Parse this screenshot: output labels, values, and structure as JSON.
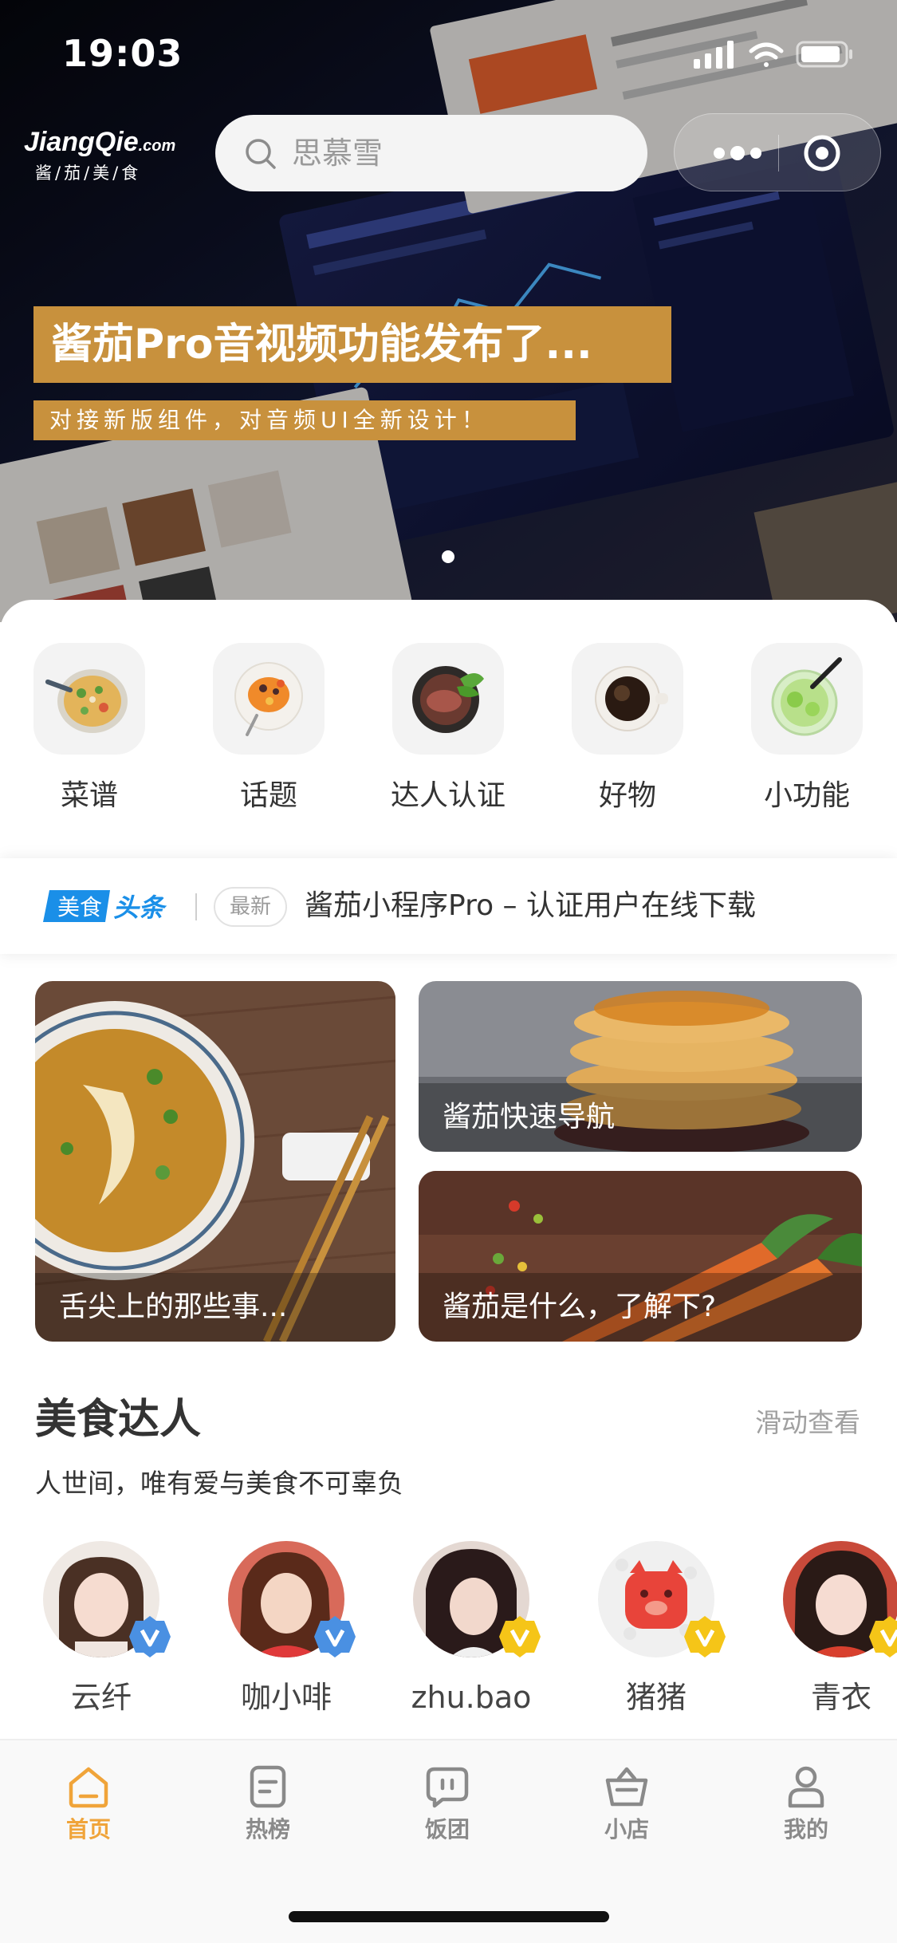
{
  "status_bar": {
    "time": "19:03"
  },
  "brand": {
    "name": "JiangQie",
    "suffix": ".com",
    "subtitle": "酱/茄/美/食"
  },
  "search": {
    "placeholder": "思慕雪"
  },
  "banner": {
    "title": "酱茄Pro音视频功能发布了...",
    "subtitle": "对接新版组件，对音频UI全新设计！",
    "pages": 1,
    "active_page": 1
  },
  "categories": [
    {
      "label": "菜谱",
      "icon": "noodle-bowl-icon"
    },
    {
      "label": "话题",
      "icon": "fruit-plate-icon"
    },
    {
      "label": "达人认证",
      "icon": "steak-plate-icon"
    },
    {
      "label": "好物",
      "icon": "coffee-cup-icon"
    },
    {
      "label": "小功能",
      "icon": "lime-drink-icon"
    }
  ],
  "news": {
    "logo_part1": "美食",
    "logo_part2": "头条",
    "badge": "最新",
    "text": "酱茄小程序Pro – 认证用户在线下载"
  },
  "cards": {
    "left": "舌尖上的那些事...",
    "top_right": "酱茄快速导航",
    "bottom_right": "酱茄是什么，了解下?"
  },
  "experts_section": {
    "title": "美食达人",
    "more": "滑动查看",
    "subtitle": "人世间，唯有爱与美食不可辜负",
    "items": [
      {
        "name": "云纤",
        "badge_color": "#4a90e2"
      },
      {
        "name": "咖小啡",
        "badge_color": "#4a90e2"
      },
      {
        "name": "zhu.bao",
        "badge_color": "#f5c518"
      },
      {
        "name": "猪猪",
        "badge_color": "#f5c518"
      },
      {
        "name": "青衣",
        "badge_color": "#f5c518"
      }
    ]
  },
  "tabbar": {
    "active": "首页",
    "items": [
      {
        "label": "首页",
        "icon": "home-icon"
      },
      {
        "label": "热榜",
        "icon": "list-icon"
      },
      {
        "label": "饭团",
        "icon": "chat-bubble-icon"
      },
      {
        "label": "小店",
        "icon": "basket-icon"
      },
      {
        "label": "我的",
        "icon": "person-icon"
      }
    ]
  },
  "colors": {
    "accent": "#f0a43a",
    "banner_label": "#c8913d",
    "news_logo": "#1a8fe8",
    "verified_blue": "#4a90e2",
    "verified_gold": "#f5c518"
  }
}
